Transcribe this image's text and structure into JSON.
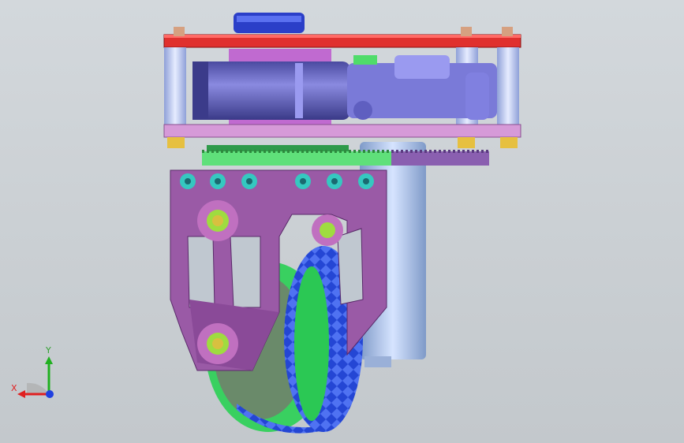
{
  "viewport": {
    "background": "#c8cdd1"
  },
  "triad": {
    "x_label": "X",
    "y_label": "Y",
    "x_color": "#e02020",
    "y_color": "#20b020",
    "z_color": "#2040e0",
    "icons": [
      "x-axis-icon",
      "y-axis-icon",
      "z-axis-icon"
    ]
  },
  "colors": {
    "top_plate": "#e0302e",
    "middle_plate": "#d69ad8",
    "standoff": "#b9c4ea",
    "motor": "#6b6bc4",
    "bracket": "#9a5aa6",
    "gear_green": "#4fdc6a",
    "gear_purple": "#8a5fb0",
    "tire": "#2a4fd8",
    "rim": "#39d060",
    "hub": "#7a8f7a",
    "drive_motor": "#a8c0e8",
    "nut": "#e6c040",
    "screw": "#35c8c0"
  }
}
